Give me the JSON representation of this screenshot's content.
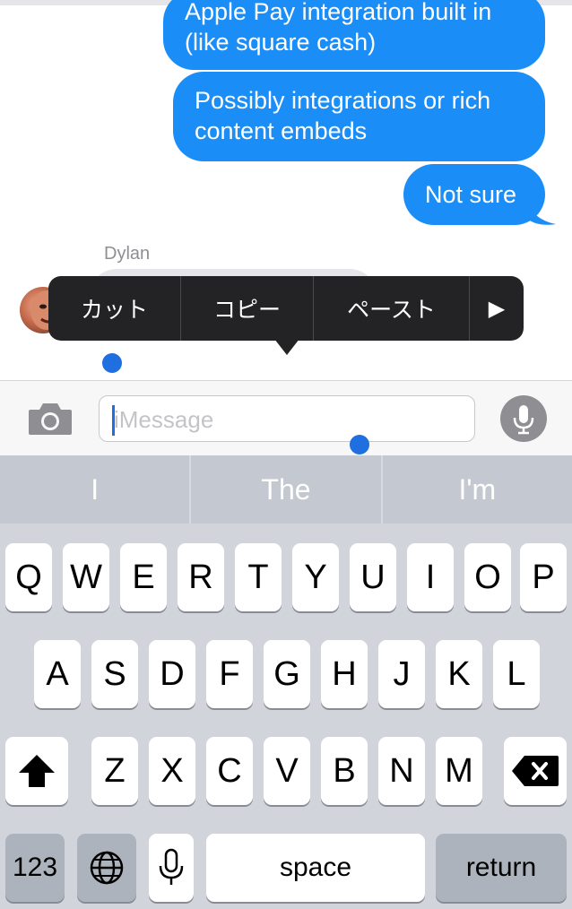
{
  "messages": [
    {
      "text_line1": "Apple Pay integration built in",
      "text_line2": "(like square cash)"
    },
    {
      "text_line1": "Possibly integrations or rich",
      "text_line2": "content embeds"
    },
    {
      "text_line1": "Not sure"
    }
  ],
  "incoming": {
    "sender": "Dylan"
  },
  "edit_menu": {
    "items": [
      "カット",
      "コピー",
      "ペースト"
    ],
    "more_label": "▶"
  },
  "input": {
    "placeholder": "iMessage",
    "value": ""
  },
  "predictions": [
    "I",
    "The",
    "I'm"
  ],
  "keyboard": {
    "row1": [
      "Q",
      "W",
      "E",
      "R",
      "T",
      "Y",
      "U",
      "I",
      "O",
      "P"
    ],
    "row2": [
      "A",
      "S",
      "D",
      "F",
      "G",
      "H",
      "J",
      "K",
      "L"
    ],
    "row3": [
      "Z",
      "X",
      "C",
      "V",
      "B",
      "N",
      "M"
    ],
    "numbers_label": "123",
    "space_label": "space",
    "return_label": "return"
  },
  "icons": {
    "camera": "camera-icon",
    "mic": "microphone-icon",
    "globe": "globe-icon",
    "shift": "shift-icon",
    "delete": "delete-icon"
  },
  "colors": {
    "bubble_blue": "#1b8df6",
    "menu_dark": "#232325",
    "selection_blue": "#1f6fe0"
  }
}
